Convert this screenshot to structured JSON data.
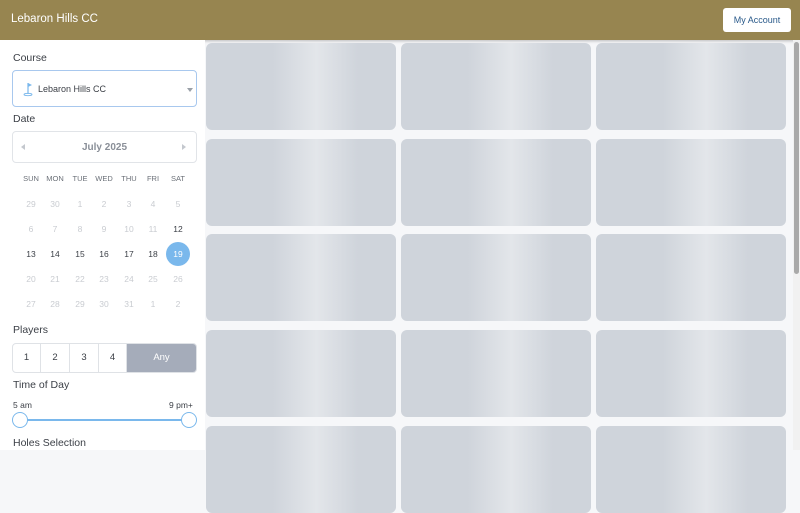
{
  "header": {
    "title": "Lebaron Hills CC",
    "account_label": "My Account",
    "bar_color": "#978550"
  },
  "sidebar": {
    "course_label": "Course",
    "course_value": "Lebaron Hills CC",
    "date_label": "Date",
    "calendar": {
      "month": "July 2025",
      "weekdays": [
        "SUN",
        "MON",
        "TUE",
        "WED",
        "THU",
        "FRI",
        "SAT"
      ],
      "weeks": [
        [
          "29",
          "30",
          "1",
          "2",
          "3",
          "4",
          "5"
        ],
        [
          "6",
          "7",
          "8",
          "9",
          "10",
          "11",
          "12"
        ],
        [
          "13",
          "14",
          "15",
          "16",
          "17",
          "18",
          "19"
        ],
        [
          "20",
          "21",
          "22",
          "23",
          "24",
          "25",
          "26"
        ],
        [
          "27",
          "28",
          "29",
          "30",
          "31",
          "1",
          "2"
        ]
      ],
      "selected_day": "19"
    },
    "players_label": "Players",
    "players_options": [
      "1",
      "2",
      "3",
      "4",
      "Any"
    ],
    "players_selected": "Any",
    "time_label": "Time of Day",
    "time_min": "5 am",
    "time_max": "9 pm+",
    "holes_label": "Holes Selection"
  },
  "accent_color": "#7ab8ec"
}
